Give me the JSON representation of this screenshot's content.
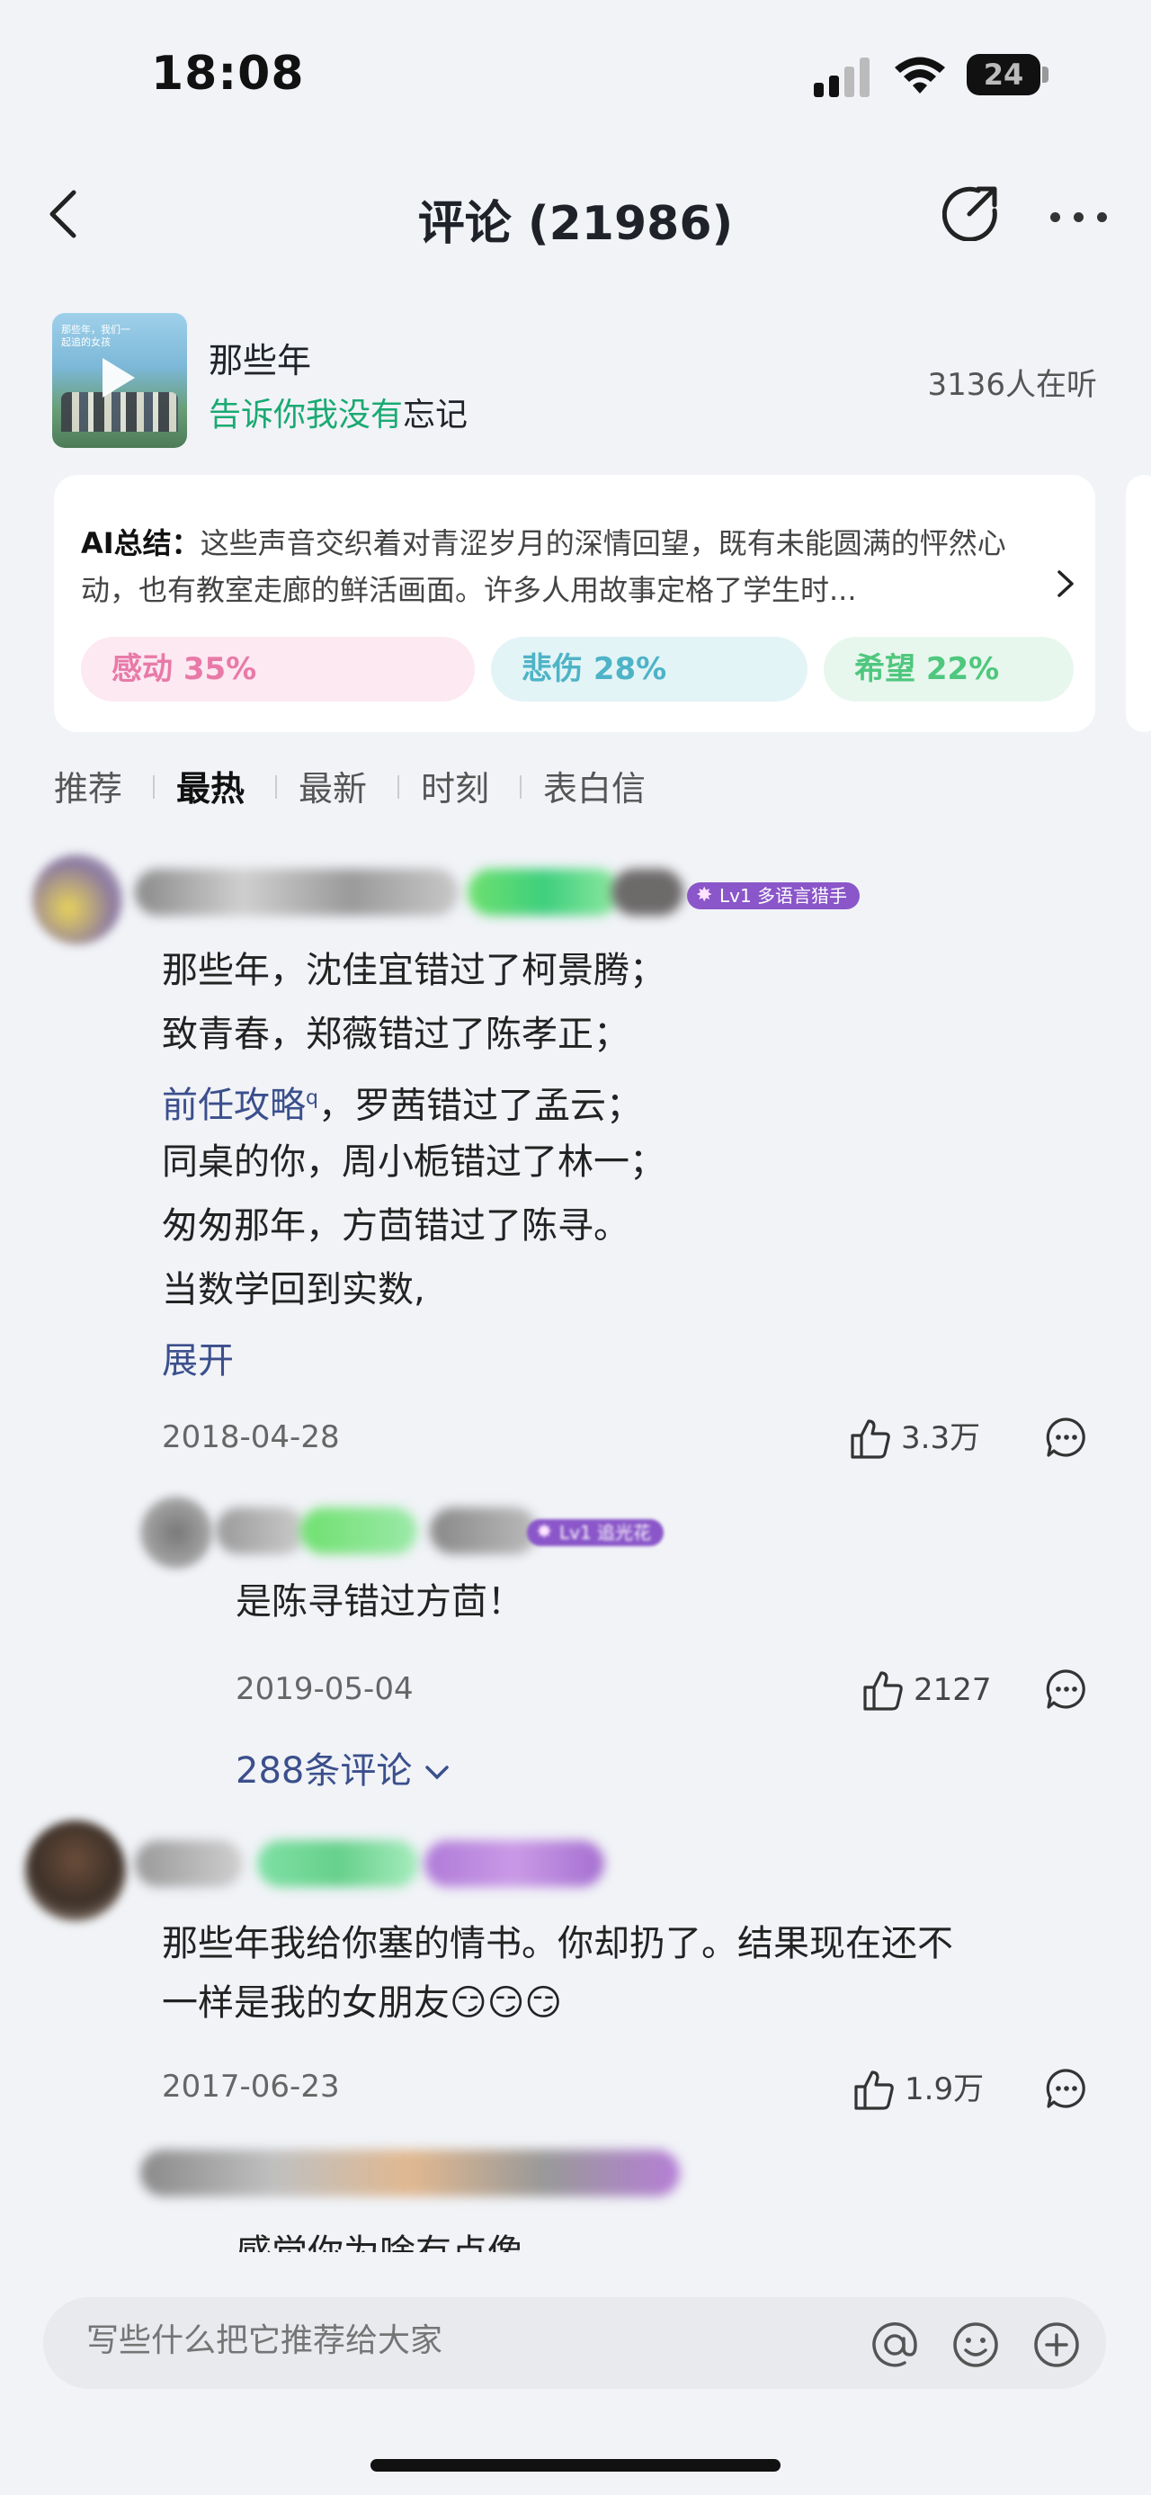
{
  "status_bar": {
    "time": "18:08",
    "battery": "24"
  },
  "nav": {
    "title": "评论 (21986)"
  },
  "song": {
    "name": "那些年",
    "artist_highlight": "告诉你我没有",
    "artist_rest": "忘记",
    "listeners": "3136人在听",
    "cover_text": "那些年，我们一起追的女孩"
  },
  "ai_summary": {
    "label": "AI总结：",
    "text": "这些声音交织着对青涩岁月的深情回望，既有未能圆满的怦然心动，也有教室走廊的鲜活画面。许多人用故事定格了学生时...",
    "emotions": [
      {
        "label": "感动 35%",
        "color": "#e87aa8"
      },
      {
        "label": "悲伤 28%",
        "color": "#4eb3c7"
      },
      {
        "label": "希望 22%",
        "color": "#4fc77e"
      }
    ]
  },
  "tabs": [
    "推荐",
    "最热",
    "最新",
    "时刻",
    "表白信"
  ],
  "active_tab": "最热",
  "comments": [
    {
      "badge": "Lv1 多语言猎手",
      "lines": [
        "那些年，沈佳宜错过了柯景腾；",
        "致青春，郑薇错过了陈孝正；",
        "，罗茜错过了孟云；",
        "同桌的你，周小栀错过了林一；",
        "匆匆那年，方茴错过了陈寻。",
        "当数学回到实数,"
      ],
      "link": "前任攻略",
      "link_mark": "q",
      "expand": "展开",
      "date": "2018-04-28",
      "likes": "3.3万",
      "reply": {
        "badge": "Lv1 追光花",
        "text": "是陈寻错过方茴！",
        "date": "2019-05-04",
        "likes": "2127"
      },
      "more_replies": "288条评论"
    },
    {
      "text_line1": "那些年我给你塞的情书。你却扔了。结果现在还不",
      "text_line2": "一样是我的女朋友😏😏😏",
      "date": "2017-06-23",
      "likes": "1.9万",
      "next_preview": "感觉你为啥有点像"
    }
  ],
  "input": {
    "placeholder": "写些什么把它推荐给大家"
  }
}
